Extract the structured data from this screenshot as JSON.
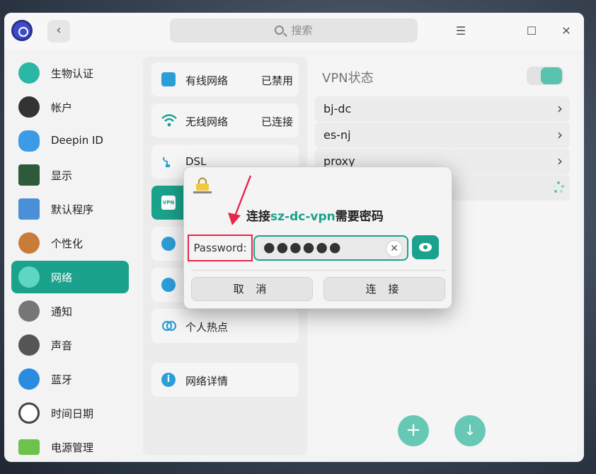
{
  "titlebar": {
    "search_placeholder": "搜索",
    "back_icon": "chevron-left-icon",
    "menu_icon": "hamburger-icon",
    "maximize_icon": "maximize-icon",
    "close_icon": "close-icon"
  },
  "sidebar": {
    "items": [
      {
        "label": "生物认证",
        "icon": "fingerprint-icon",
        "color": "#2bb7a5"
      },
      {
        "label": "帐户",
        "icon": "user-icon",
        "color": "#333333"
      },
      {
        "label": "Deepin ID",
        "icon": "cloud-icon",
        "color": "#3a9be8"
      },
      {
        "label": "显示",
        "icon": "monitor-icon",
        "color": "#2d5a3a"
      },
      {
        "label": "默认程序",
        "icon": "default-apps-icon",
        "color": "#4a90d9"
      },
      {
        "label": "个性化",
        "icon": "palette-icon",
        "color": "#c97b3a"
      },
      {
        "label": "网络",
        "icon": "network-icon",
        "color": "#5fd6c3",
        "active": true
      },
      {
        "label": "通知",
        "icon": "bell-icon",
        "color": "#777777"
      },
      {
        "label": "声音",
        "icon": "speaker-icon",
        "color": "#555555"
      },
      {
        "label": "蓝牙",
        "icon": "bluetooth-icon",
        "color": "#2b8be0"
      },
      {
        "label": "时间日期",
        "icon": "clock-icon",
        "color": "#444444"
      },
      {
        "label": "电源管理",
        "icon": "battery-icon",
        "color": "#6cc24a"
      }
    ]
  },
  "network_menu": {
    "items": [
      {
        "label": "有线网络",
        "status": "已禁用",
        "icon": "wired-icon"
      },
      {
        "label": "无线网络",
        "status": "已连接",
        "icon": "wifi-icon"
      },
      {
        "label": "DSL",
        "status": "",
        "icon": "dsl-icon"
      },
      {
        "label": "",
        "status": "",
        "icon": "vpn-icon",
        "active": true,
        "badge": "VPN"
      },
      {
        "label": "",
        "status": "",
        "icon": "proxy-icon"
      },
      {
        "label": "",
        "status": "",
        "icon": "app-proxy-icon"
      },
      {
        "label": "个人热点",
        "status": "",
        "icon": "hotspot-icon"
      },
      {
        "label": "网络详情",
        "status": "",
        "icon": "info-icon"
      }
    ]
  },
  "vpn": {
    "title": "VPN状态",
    "enabled": true,
    "connections": [
      {
        "name": "bj-dc"
      },
      {
        "name": "es-nj"
      },
      {
        "name": "proxy"
      },
      {
        "name": ""
      }
    ],
    "add_icon": "plus-icon",
    "import_icon": "download-icon"
  },
  "dialog": {
    "title_prefix": "连接",
    "title_highlight": "sz-dc-vpn",
    "title_suffix": "需要密码",
    "password_label": "Password:",
    "password_value": "●●●●●●",
    "cancel_label": "取 消",
    "connect_label": "连 接",
    "accent": "#1aa28c",
    "highlight_border": "#e8264a"
  }
}
